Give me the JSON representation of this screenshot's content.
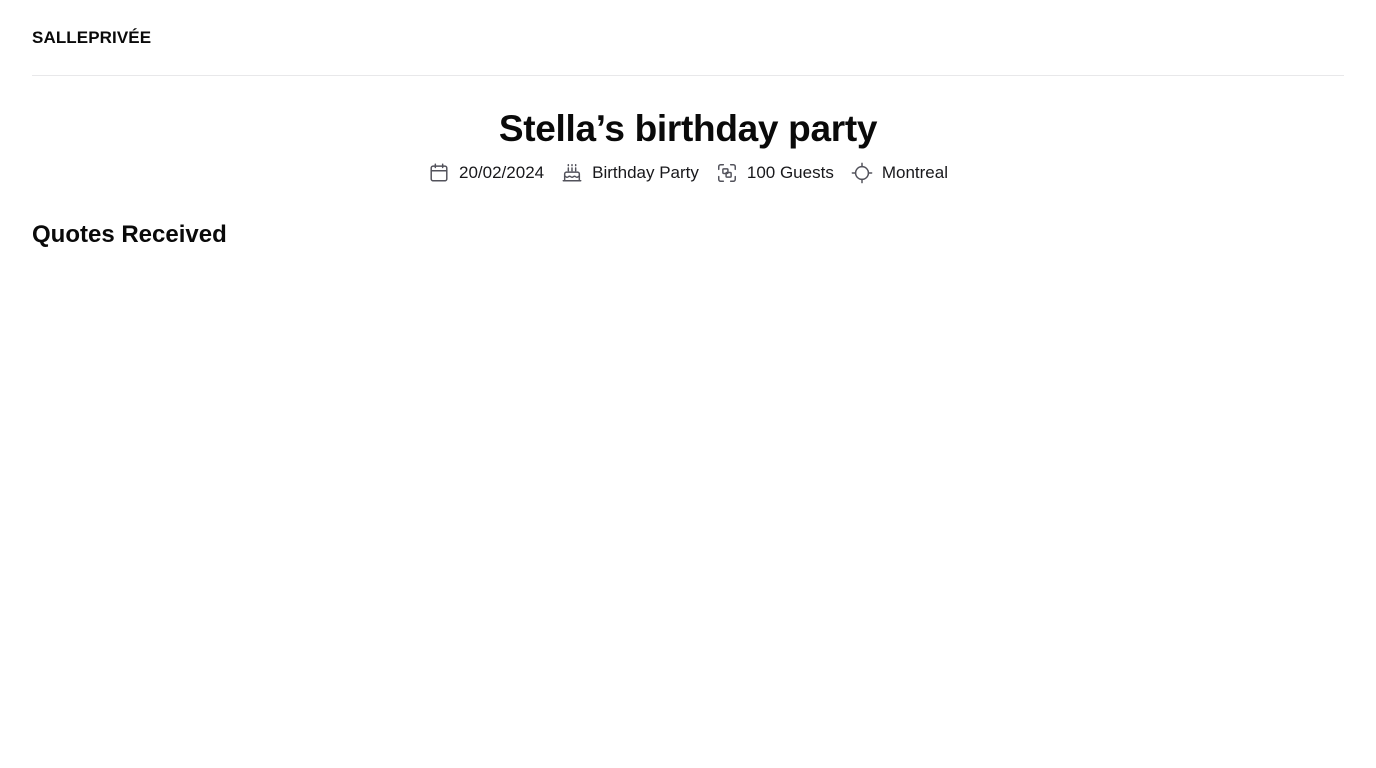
{
  "header": {
    "brand": "SALLEPRIVÉE"
  },
  "event": {
    "title": "Stella’s birthday party",
    "meta": [
      {
        "icon": "calendar-icon",
        "text": "20/02/2024"
      },
      {
        "icon": "cake-icon",
        "text": "Birthday Party"
      },
      {
        "icon": "guests-icon",
        "text": "100 Guests"
      },
      {
        "icon": "location-target-icon",
        "text": "Montreal"
      }
    ]
  },
  "main": {
    "section_title": "Quotes Received"
  },
  "colors": {
    "text": "#0a0a0a",
    "icon": "#52525b",
    "divider": "#e8e8ea",
    "background": "#ffffff"
  }
}
